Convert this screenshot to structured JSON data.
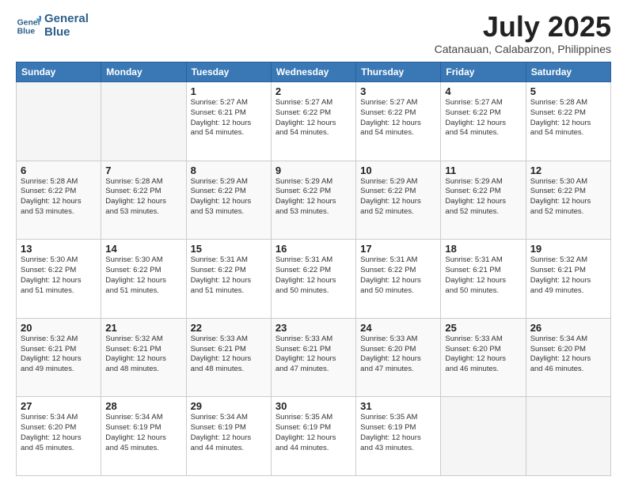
{
  "header": {
    "logo_line1": "General",
    "logo_line2": "Blue",
    "month_year": "July 2025",
    "location": "Catanauan, Calabarzon, Philippines"
  },
  "weekdays": [
    "Sunday",
    "Monday",
    "Tuesday",
    "Wednesday",
    "Thursday",
    "Friday",
    "Saturday"
  ],
  "weeks": [
    [
      {
        "day": "",
        "info": ""
      },
      {
        "day": "",
        "info": ""
      },
      {
        "day": "1",
        "info": "Sunrise: 5:27 AM\nSunset: 6:21 PM\nDaylight: 12 hours\nand 54 minutes."
      },
      {
        "day": "2",
        "info": "Sunrise: 5:27 AM\nSunset: 6:22 PM\nDaylight: 12 hours\nand 54 minutes."
      },
      {
        "day": "3",
        "info": "Sunrise: 5:27 AM\nSunset: 6:22 PM\nDaylight: 12 hours\nand 54 minutes."
      },
      {
        "day": "4",
        "info": "Sunrise: 5:27 AM\nSunset: 6:22 PM\nDaylight: 12 hours\nand 54 minutes."
      },
      {
        "day": "5",
        "info": "Sunrise: 5:28 AM\nSunset: 6:22 PM\nDaylight: 12 hours\nand 54 minutes."
      }
    ],
    [
      {
        "day": "6",
        "info": "Sunrise: 5:28 AM\nSunset: 6:22 PM\nDaylight: 12 hours\nand 53 minutes."
      },
      {
        "day": "7",
        "info": "Sunrise: 5:28 AM\nSunset: 6:22 PM\nDaylight: 12 hours\nand 53 minutes."
      },
      {
        "day": "8",
        "info": "Sunrise: 5:29 AM\nSunset: 6:22 PM\nDaylight: 12 hours\nand 53 minutes."
      },
      {
        "day": "9",
        "info": "Sunrise: 5:29 AM\nSunset: 6:22 PM\nDaylight: 12 hours\nand 53 minutes."
      },
      {
        "day": "10",
        "info": "Sunrise: 5:29 AM\nSunset: 6:22 PM\nDaylight: 12 hours\nand 52 minutes."
      },
      {
        "day": "11",
        "info": "Sunrise: 5:29 AM\nSunset: 6:22 PM\nDaylight: 12 hours\nand 52 minutes."
      },
      {
        "day": "12",
        "info": "Sunrise: 5:30 AM\nSunset: 6:22 PM\nDaylight: 12 hours\nand 52 minutes."
      }
    ],
    [
      {
        "day": "13",
        "info": "Sunrise: 5:30 AM\nSunset: 6:22 PM\nDaylight: 12 hours\nand 51 minutes."
      },
      {
        "day": "14",
        "info": "Sunrise: 5:30 AM\nSunset: 6:22 PM\nDaylight: 12 hours\nand 51 minutes."
      },
      {
        "day": "15",
        "info": "Sunrise: 5:31 AM\nSunset: 6:22 PM\nDaylight: 12 hours\nand 51 minutes."
      },
      {
        "day": "16",
        "info": "Sunrise: 5:31 AM\nSunset: 6:22 PM\nDaylight: 12 hours\nand 50 minutes."
      },
      {
        "day": "17",
        "info": "Sunrise: 5:31 AM\nSunset: 6:22 PM\nDaylight: 12 hours\nand 50 minutes."
      },
      {
        "day": "18",
        "info": "Sunrise: 5:31 AM\nSunset: 6:21 PM\nDaylight: 12 hours\nand 50 minutes."
      },
      {
        "day": "19",
        "info": "Sunrise: 5:32 AM\nSunset: 6:21 PM\nDaylight: 12 hours\nand 49 minutes."
      }
    ],
    [
      {
        "day": "20",
        "info": "Sunrise: 5:32 AM\nSunset: 6:21 PM\nDaylight: 12 hours\nand 49 minutes."
      },
      {
        "day": "21",
        "info": "Sunrise: 5:32 AM\nSunset: 6:21 PM\nDaylight: 12 hours\nand 48 minutes."
      },
      {
        "day": "22",
        "info": "Sunrise: 5:33 AM\nSunset: 6:21 PM\nDaylight: 12 hours\nand 48 minutes."
      },
      {
        "day": "23",
        "info": "Sunrise: 5:33 AM\nSunset: 6:21 PM\nDaylight: 12 hours\nand 47 minutes."
      },
      {
        "day": "24",
        "info": "Sunrise: 5:33 AM\nSunset: 6:20 PM\nDaylight: 12 hours\nand 47 minutes."
      },
      {
        "day": "25",
        "info": "Sunrise: 5:33 AM\nSunset: 6:20 PM\nDaylight: 12 hours\nand 46 minutes."
      },
      {
        "day": "26",
        "info": "Sunrise: 5:34 AM\nSunset: 6:20 PM\nDaylight: 12 hours\nand 46 minutes."
      }
    ],
    [
      {
        "day": "27",
        "info": "Sunrise: 5:34 AM\nSunset: 6:20 PM\nDaylight: 12 hours\nand 45 minutes."
      },
      {
        "day": "28",
        "info": "Sunrise: 5:34 AM\nSunset: 6:19 PM\nDaylight: 12 hours\nand 45 minutes."
      },
      {
        "day": "29",
        "info": "Sunrise: 5:34 AM\nSunset: 6:19 PM\nDaylight: 12 hours\nand 44 minutes."
      },
      {
        "day": "30",
        "info": "Sunrise: 5:35 AM\nSunset: 6:19 PM\nDaylight: 12 hours\nand 44 minutes."
      },
      {
        "day": "31",
        "info": "Sunrise: 5:35 AM\nSunset: 6:19 PM\nDaylight: 12 hours\nand 43 minutes."
      },
      {
        "day": "",
        "info": ""
      },
      {
        "day": "",
        "info": ""
      }
    ]
  ]
}
